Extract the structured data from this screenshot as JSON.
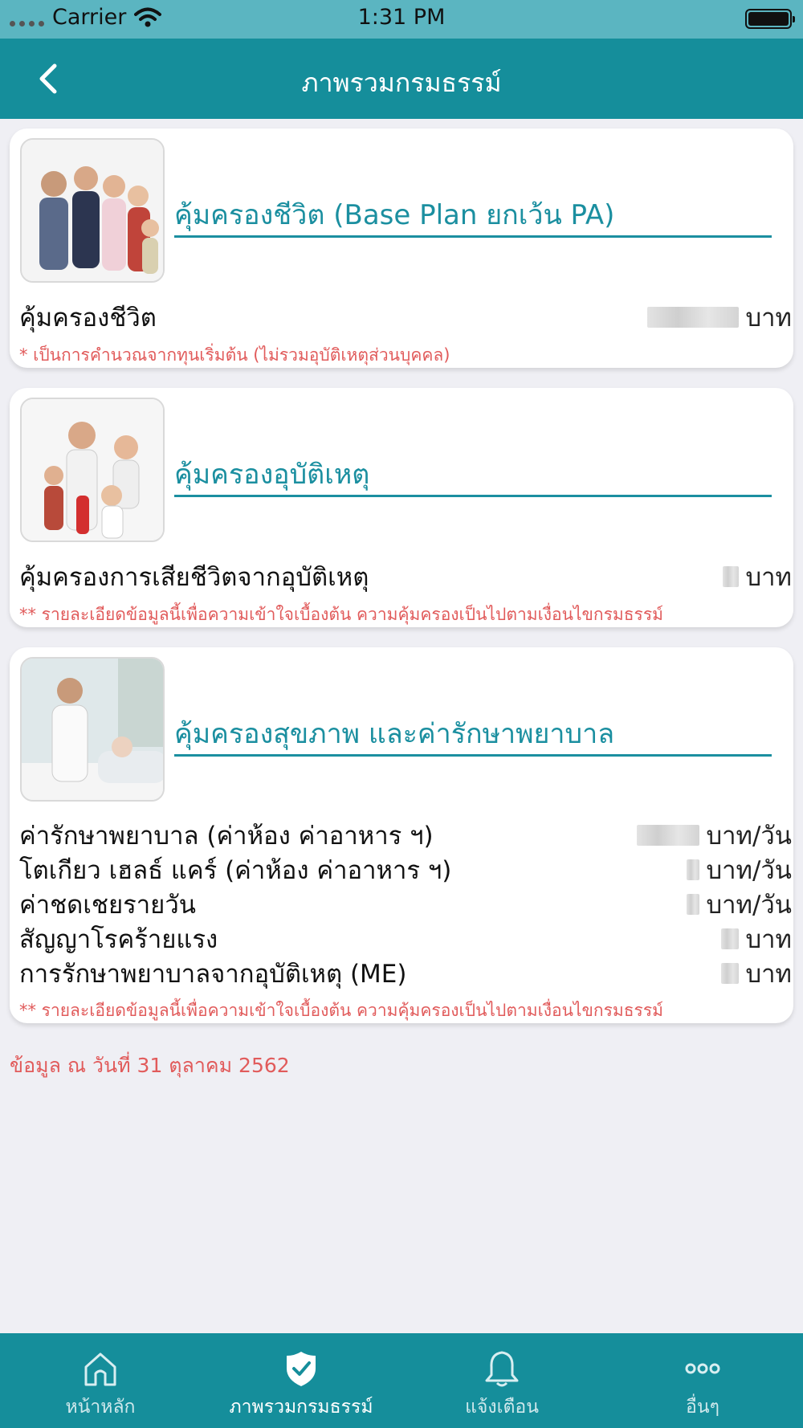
{
  "status_bar": {
    "carrier": "Carrier",
    "time": "1:31 PM"
  },
  "nav": {
    "title": "ภาพรวมกรมธรรม์"
  },
  "cards": [
    {
      "title": "คุ้มครองชีวิต (Base Plan ยกเว้น PA)",
      "rows": [
        {
          "label": "คุ้มครองชีวิต",
          "unit": "บาท"
        }
      ],
      "note": "* เป็นการคำนวณจากทุนเริ่มต้น (ไม่รวมอุบัติเหตุส่วนบุคคล)"
    },
    {
      "title": "คุ้มครองอุบัติเหตุ",
      "rows": [
        {
          "label": "คุ้มครองการเสียชีวิตจากอุบัติเหตุ",
          "unit": "บาท"
        }
      ],
      "note": "** รายละเอียดข้อมูลนี้เพื่อความเข้าใจเบื้องต้น ความคุ้มครองเป็นไปตามเงื่อนไขกรมธรรม์"
    },
    {
      "title": "คุ้มครองสุขภาพ และค่ารักษาพยาบาล",
      "rows": [
        {
          "label": "ค่ารักษาพยาบาล (ค่าห้อง ค่าอาหาร ฯ)",
          "unit": "บาท/วัน"
        },
        {
          "label": "โตเกียว เฮลธ์ แคร์ (ค่าห้อง ค่าอาหาร ฯ)",
          "unit": "บาท/วัน"
        },
        {
          "label": "ค่าชดเชยรายวัน",
          "unit": "บาท/วัน"
        },
        {
          "label": "สัญญาโรคร้ายแรง",
          "unit": "บาท"
        },
        {
          "label": "การรักษาพยาบาลจากอุบัติเหตุ (ME)",
          "unit": "บาท"
        }
      ],
      "note": "** รายละเอียดข้อมูลนี้เพื่อความเข้าใจเบื้องต้น ความคุ้มครองเป็นไปตามเงื่อนไขกรมธรรม์"
    }
  ],
  "date_note": "ข้อมูล ณ วันที่ 31 ตุลาคม 2562",
  "tabs": [
    {
      "label": "หน้าหลัก",
      "icon": "home-icon"
    },
    {
      "label": "ภาพรวมกรมธรรม์",
      "icon": "shield-check-icon",
      "active": true
    },
    {
      "label": "แจ้งเตือน",
      "icon": "bell-icon"
    },
    {
      "label": "อื่นๆ",
      "icon": "more-dots-icon"
    }
  ],
  "colors": {
    "primary": "#158e9b",
    "status_bar": "#5bb5c1",
    "accent_text": "#1b8fa0",
    "note_red": "#e15b5b",
    "background": "#efeff4"
  }
}
